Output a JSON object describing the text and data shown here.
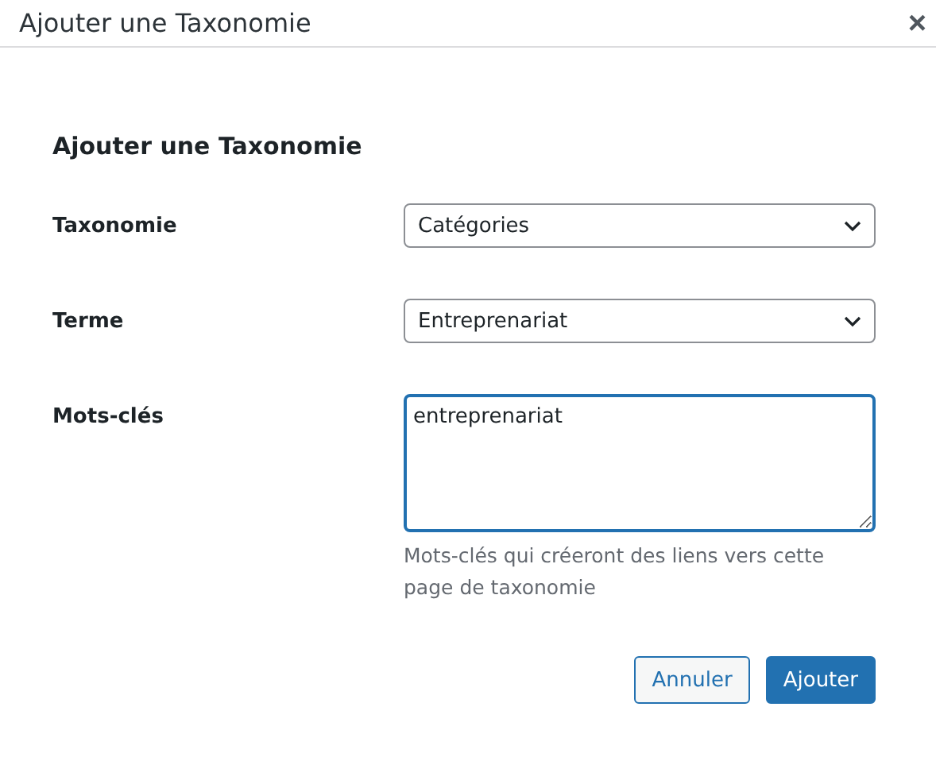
{
  "window": {
    "title": "Ajouter une Taxonomie",
    "close": "×"
  },
  "form": {
    "heading": "Ajouter une Taxonomie",
    "fields": [
      {
        "kind": "select",
        "label": "Taxonomie",
        "value": "Catégories"
      },
      {
        "kind": "select",
        "label": "Terme",
        "value": "Entreprenariat"
      },
      {
        "kind": "textarea",
        "label": "Mots-clés",
        "value": "entreprenariat",
        "focused": true,
        "help": "Mots-clés qui créeront des liens vers cette page de taxonomie"
      }
    ]
  },
  "buttons": [
    {
      "label": "Annuler",
      "primary": false
    },
    {
      "label": "Ajouter",
      "primary": true
    }
  ]
}
